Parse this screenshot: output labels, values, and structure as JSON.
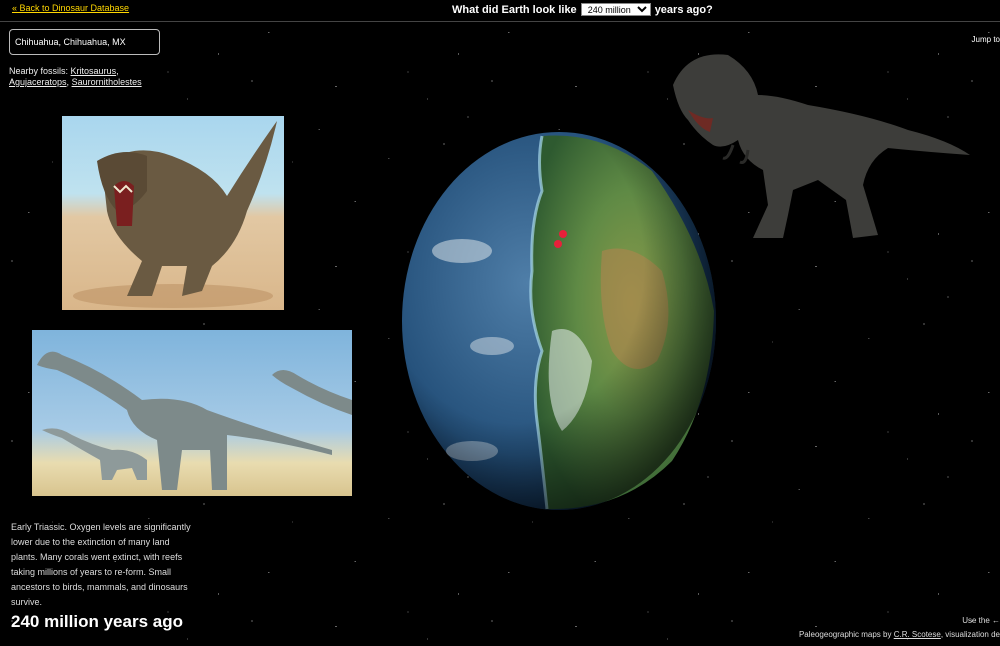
{
  "header": {
    "back_link": "« Back to Dinosaur Database",
    "question_prefix": "What did Earth look like",
    "question_suffix": "years ago?",
    "era_selected": "240 million"
  },
  "location": {
    "value": "Chihuahua, Chihuahua, MX"
  },
  "jump_to": "Jump to",
  "nearby": {
    "label": "Nearby fossils:",
    "fossils": [
      "Kritosaurus",
      "Agujaceratops",
      "Saurornitholestes"
    ]
  },
  "description": "Early Triassic. Oxygen levels are significantly lower due to the extinction of many land plants. Many corals went extinct, with reefs taking millions of years to re-form. Small ancestors to birds, mammals, and dinosaurs survive.",
  "years_heading": "240 million years ago",
  "footer": {
    "use_hint": "Use the ←",
    "credits_prefix": "Paleogeographic maps by",
    "credits_author": "C.R. Scotese",
    "credits_suffix": ", visualization de"
  },
  "colors": {
    "link_accent": "#ffd700",
    "background": "#000000",
    "fossil_marker": "#e8203a"
  }
}
